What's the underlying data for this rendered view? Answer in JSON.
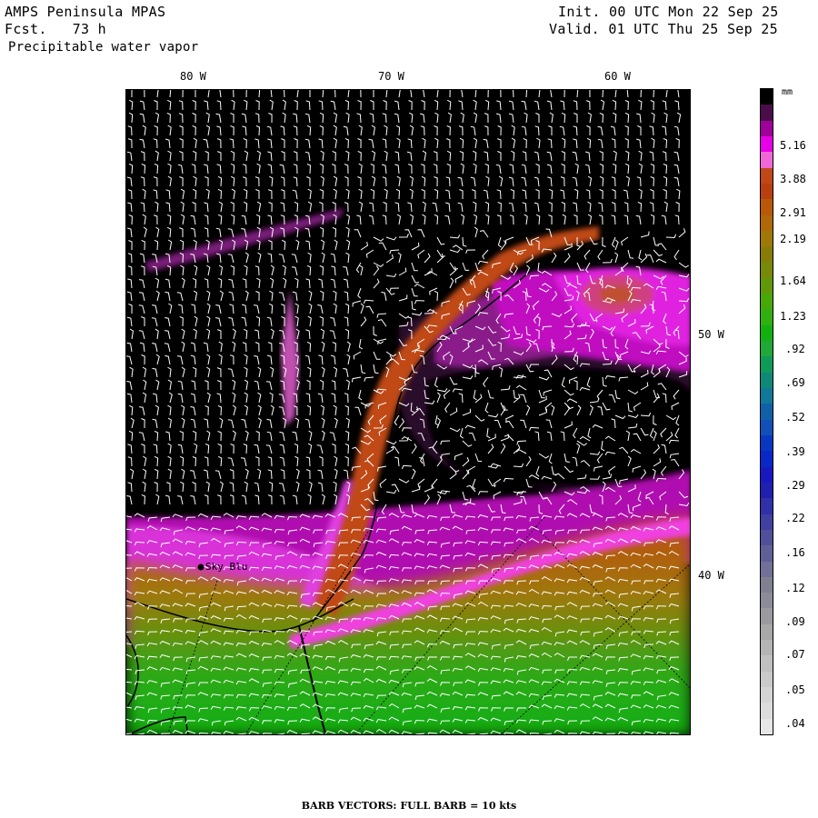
{
  "header": {
    "model": "AMPS Peninsula MPAS",
    "forecast": "Fcst.   73 h",
    "field": "Precipitable water vapor",
    "init": "Init. 00 UTC Mon 22 Sep 25",
    "valid": "Valid. 01 UTC Thu 25 Sep 25"
  },
  "lon_labels": [
    "80 W",
    "70 W",
    "60 W"
  ],
  "lat_labels": [
    "50 W",
    "40 W"
  ],
  "station": {
    "name": "Sky Blu"
  },
  "colorbar": {
    "unit": "mm",
    "labels": [
      "5.16",
      "3.88",
      "2.91",
      "2.19",
      "1.64",
      "1.23",
      ".92",
      ".69",
      ".52",
      ".39",
      ".29",
      ".22",
      ".16",
      ".12",
      ".09",
      ".07",
      ".05",
      ".04"
    ],
    "colors": [
      "#000000",
      "#4a0d4a",
      "#a0009a",
      "#e600e6",
      "#f068d8",
      "#c04818",
      "#b84010",
      "#b85808",
      "#b06808",
      "#a07808",
      "#887c08",
      "#788808",
      "#609808",
      "#48a808",
      "#30b010",
      "#10b010",
      "#20a838",
      "#109a58",
      "#108878",
      "#107898",
      "#1060a8",
      "#1050b8",
      "#0838c0",
      "#0828c8",
      "#1818c0",
      "#2020b0",
      "#3030a8",
      "#4040a0",
      "#50509a",
      "#606098",
      "#707098",
      "#808090",
      "#8c8c98",
      "#9a9aa0",
      "#a8a8a8",
      "#b4b4b4",
      "#c0c0c0",
      "#cacaca",
      "#d4d4d4",
      "#dcdcdc",
      "#e6e6e6"
    ]
  },
  "footer": "BARB VECTORS:  FULL BARB = 10 kts"
}
